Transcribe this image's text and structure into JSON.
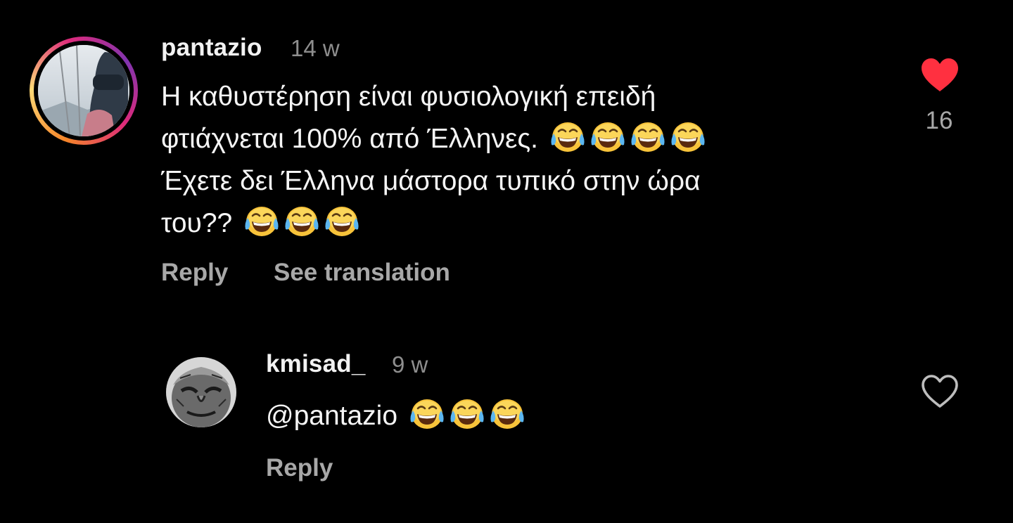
{
  "comments": [
    {
      "username": "pantazio",
      "time": "14 w",
      "lines": [
        "Η καθυστέρηση είναι φυσιολογική επειδή",
        "φτιάχνεται 100% από Έλληνες.",
        "Έχετε δει Έλληνα μάστορα τυπικό στην ώρα",
        "του??"
      ],
      "reply_label": "Reply",
      "translate_label": "See translation",
      "like_count": "16",
      "liked": true,
      "like_color": "#ff3040"
    },
    {
      "username": "kmisad_",
      "time": "9 w",
      "lines": [
        "@pantazio"
      ],
      "reply_label": "Reply",
      "liked": false
    }
  ],
  "icons": {
    "emoji": "face-with-tears-of-joy",
    "like_filled": "heart-filled-icon",
    "like_outline": "heart-outline-icon"
  },
  "colors": {
    "background": "#000000",
    "primary_text": "#f5f5f5",
    "secondary_text": "#a8a8a8",
    "timestamp": "#8e8e8e"
  }
}
